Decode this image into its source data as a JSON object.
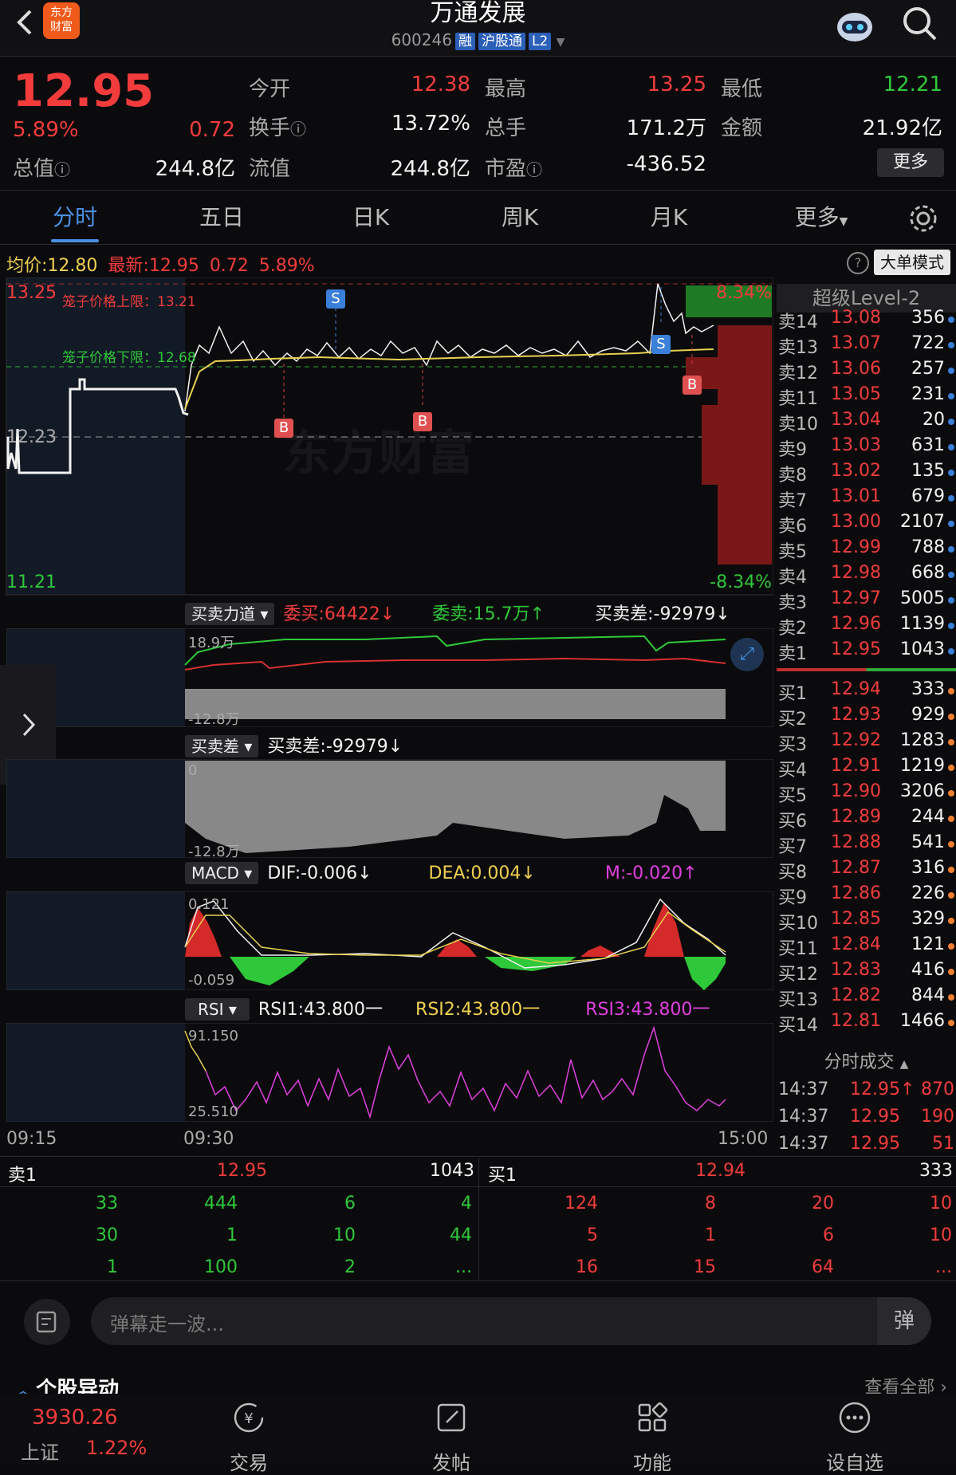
{
  "header": {
    "title": "万通发展",
    "code": "600246",
    "tags": [
      "融",
      "沪股通",
      "L2"
    ]
  },
  "quote": {
    "price": "12.95",
    "pct": "5.89%",
    "chg": "0.72",
    "fields": [
      {
        "label": "今开",
        "value": "12.38",
        "color": "red"
      },
      {
        "label": "最高",
        "value": "13.25",
        "color": "red"
      },
      {
        "label": "最低",
        "value": "12.21",
        "color": "green"
      },
      {
        "label": "换手",
        "value": "13.72%",
        "color": "white"
      },
      {
        "label": "总手",
        "value": "171.2万",
        "color": "white"
      },
      {
        "label": "金额",
        "value": "21.92亿",
        "color": "white"
      },
      {
        "label": "总值",
        "value": "244.8亿",
        "color": "white"
      },
      {
        "label": "流值",
        "value": "244.8亿",
        "color": "white"
      },
      {
        "label": "市盈",
        "value": "-436.52",
        "color": "white"
      }
    ],
    "more_btn": "更多"
  },
  "tabs": [
    "分时",
    "五日",
    "日K",
    "周K",
    "月K",
    "更多"
  ],
  "chart_header": {
    "avg_label": "均价:",
    "avg": "12.80",
    "last_label": "最新:",
    "last": "12.95",
    "chg": "0.72",
    "pct": "5.89%",
    "mode_btn": "大单模式"
  },
  "chart_labels": {
    "top_price": "13.25",
    "mid_price": "12.23",
    "bottom_price": "11.21",
    "top_pct": "8.34%",
    "bottom_pct": "-8.34%",
    "cage_upper": "笼子价格上限：13.21",
    "cage_lower": "笼子价格下限：12.68",
    "watermark": "东方财富",
    "b_marker": "B",
    "s_marker": "S"
  },
  "indicators": {
    "force": {
      "name": "买卖力道",
      "buy": "委买:64422↓",
      "sell": "委卖:15.7万↑",
      "diff": "买卖差:-92979↓",
      "top": "18.9万",
      "bottom": "-12.8万"
    },
    "diff": {
      "name": "买卖差",
      "diff": "买卖差:-92979↓",
      "top": "0",
      "bottom": "-12.8万"
    },
    "macd": {
      "name": "MACD",
      "dif": "DIF:-0.006↓",
      "dea": "DEA:0.004↓",
      "m": "M:-0.020↑",
      "top": "0.121",
      "bottom": "-0.059"
    },
    "rsi": {
      "name": "RSI",
      "rsi1": "RSI1:43.800一",
      "rsi2": "RSI2:43.800一",
      "rsi3": "RSI3:43.800一",
      "top": "91.150",
      "bottom": "25.510"
    }
  },
  "time_axis": [
    "09:15",
    "09:30",
    "15:00"
  ],
  "level2": {
    "title": "超级Level-2",
    "asks": [
      {
        "label": "卖14",
        "price": "13.08",
        "vol": "356"
      },
      {
        "label": "卖13",
        "price": "13.07",
        "vol": "722"
      },
      {
        "label": "卖12",
        "price": "13.06",
        "vol": "257"
      },
      {
        "label": "卖11",
        "price": "13.05",
        "vol": "231"
      },
      {
        "label": "卖10",
        "price": "13.04",
        "vol": "20"
      },
      {
        "label": "卖9",
        "price": "13.03",
        "vol": "631"
      },
      {
        "label": "卖8",
        "price": "13.02",
        "vol": "135"
      },
      {
        "label": "卖7",
        "price": "13.01",
        "vol": "679"
      },
      {
        "label": "卖6",
        "price": "13.00",
        "vol": "2107"
      },
      {
        "label": "卖5",
        "price": "12.99",
        "vol": "788"
      },
      {
        "label": "卖4",
        "price": "12.98",
        "vol": "668"
      },
      {
        "label": "卖3",
        "price": "12.97",
        "vol": "5005"
      },
      {
        "label": "卖2",
        "price": "12.96",
        "vol": "1139"
      },
      {
        "label": "卖1",
        "price": "12.95",
        "vol": "1043"
      }
    ],
    "bids": [
      {
        "label": "买1",
        "price": "12.94",
        "vol": "333"
      },
      {
        "label": "买2",
        "price": "12.93",
        "vol": "929"
      },
      {
        "label": "买3",
        "price": "12.92",
        "vol": "1283"
      },
      {
        "label": "买4",
        "price": "12.91",
        "vol": "1219"
      },
      {
        "label": "买5",
        "price": "12.90",
        "vol": "3206"
      },
      {
        "label": "买6",
        "price": "12.89",
        "vol": "244"
      },
      {
        "label": "买7",
        "price": "12.88",
        "vol": "541"
      },
      {
        "label": "买8",
        "price": "12.87",
        "vol": "316"
      },
      {
        "label": "买9",
        "price": "12.86",
        "vol": "226"
      },
      {
        "label": "买10",
        "price": "12.85",
        "vol": "329"
      },
      {
        "label": "买11",
        "price": "12.84",
        "vol": "121"
      },
      {
        "label": "买12",
        "price": "12.83",
        "vol": "416"
      },
      {
        "label": "买13",
        "price": "12.82",
        "vol": "844"
      },
      {
        "label": "买14",
        "price": "12.81",
        "vol": "1466"
      }
    ],
    "ticks_title": "分时成交",
    "ticks": [
      {
        "time": "14:37",
        "price": "12.95↑",
        "vol": "870"
      },
      {
        "time": "14:37",
        "price": "12.95",
        "vol": "190"
      },
      {
        "time": "14:37",
        "price": "12.95",
        "vol": "51"
      }
    ]
  },
  "queue": {
    "sell_label": "卖1",
    "sell_price": "12.95",
    "sell_vol": "1043",
    "buy_label": "买1",
    "buy_price": "12.94",
    "buy_vol": "333",
    "sell_rows": [
      [
        "33",
        "444",
        "6",
        "4"
      ],
      [
        "30",
        "1",
        "10",
        "44"
      ],
      [
        "1",
        "100",
        "2",
        "..."
      ]
    ],
    "buy_rows": [
      [
        "124",
        "8",
        "20",
        "10"
      ],
      [
        "5",
        "1",
        "6",
        "10"
      ],
      [
        "16",
        "15",
        "64",
        "..."
      ]
    ]
  },
  "danmu_placeholder": "弹幕走一波...",
  "danmu_btn": "弹",
  "section_title": "个股异动",
  "section_more": "查看全部",
  "nav": {
    "index_value": "3930.26",
    "index_name": "上证",
    "index_pct": "1.22%",
    "items": [
      "交易",
      "发帖",
      "功能",
      "设自选"
    ]
  }
}
